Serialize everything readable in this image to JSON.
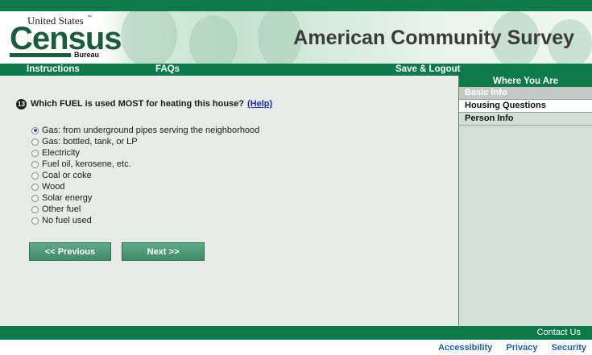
{
  "header": {
    "logo_top": "United States",
    "logo_tm": "™",
    "logo_main": "Census",
    "logo_bottom": "Bureau",
    "title": "American Community Survey"
  },
  "nav": {
    "instructions": "Instructions",
    "faqs": "FAQs",
    "save_logout": "Save & Logout"
  },
  "question": {
    "number": "13",
    "text": "Which FUEL is used MOST for heating this house?",
    "help": "(Help)",
    "options": [
      {
        "label": "Gas: from underground pipes serving the neighborhood",
        "checked": true
      },
      {
        "label": "Gas: bottled, tank, or LP",
        "checked": false
      },
      {
        "label": "Electricity",
        "checked": false
      },
      {
        "label": "Fuel oil, kerosene, etc.",
        "checked": false
      },
      {
        "label": "Coal or coke",
        "checked": false
      },
      {
        "label": "Wood",
        "checked": false
      },
      {
        "label": "Solar energy",
        "checked": false
      },
      {
        "label": "Other fuel",
        "checked": false
      },
      {
        "label": "No fuel used",
        "checked": false
      }
    ]
  },
  "buttons": {
    "previous": "<<  Previous",
    "next": "Next  >>"
  },
  "sidebar": {
    "heading": "Where You Are",
    "items": [
      {
        "label": "Basic Info",
        "state": "disabled"
      },
      {
        "label": "Housing Questions",
        "state": "current"
      },
      {
        "label": "Person Info",
        "state": "normal"
      }
    ]
  },
  "footer": {
    "contact": "Contact Us",
    "links": [
      "Accessibility",
      "Privacy",
      "Security"
    ]
  },
  "colors": {
    "brand_green": "#0e7a4a",
    "link_blue": "#1d2ab8"
  }
}
